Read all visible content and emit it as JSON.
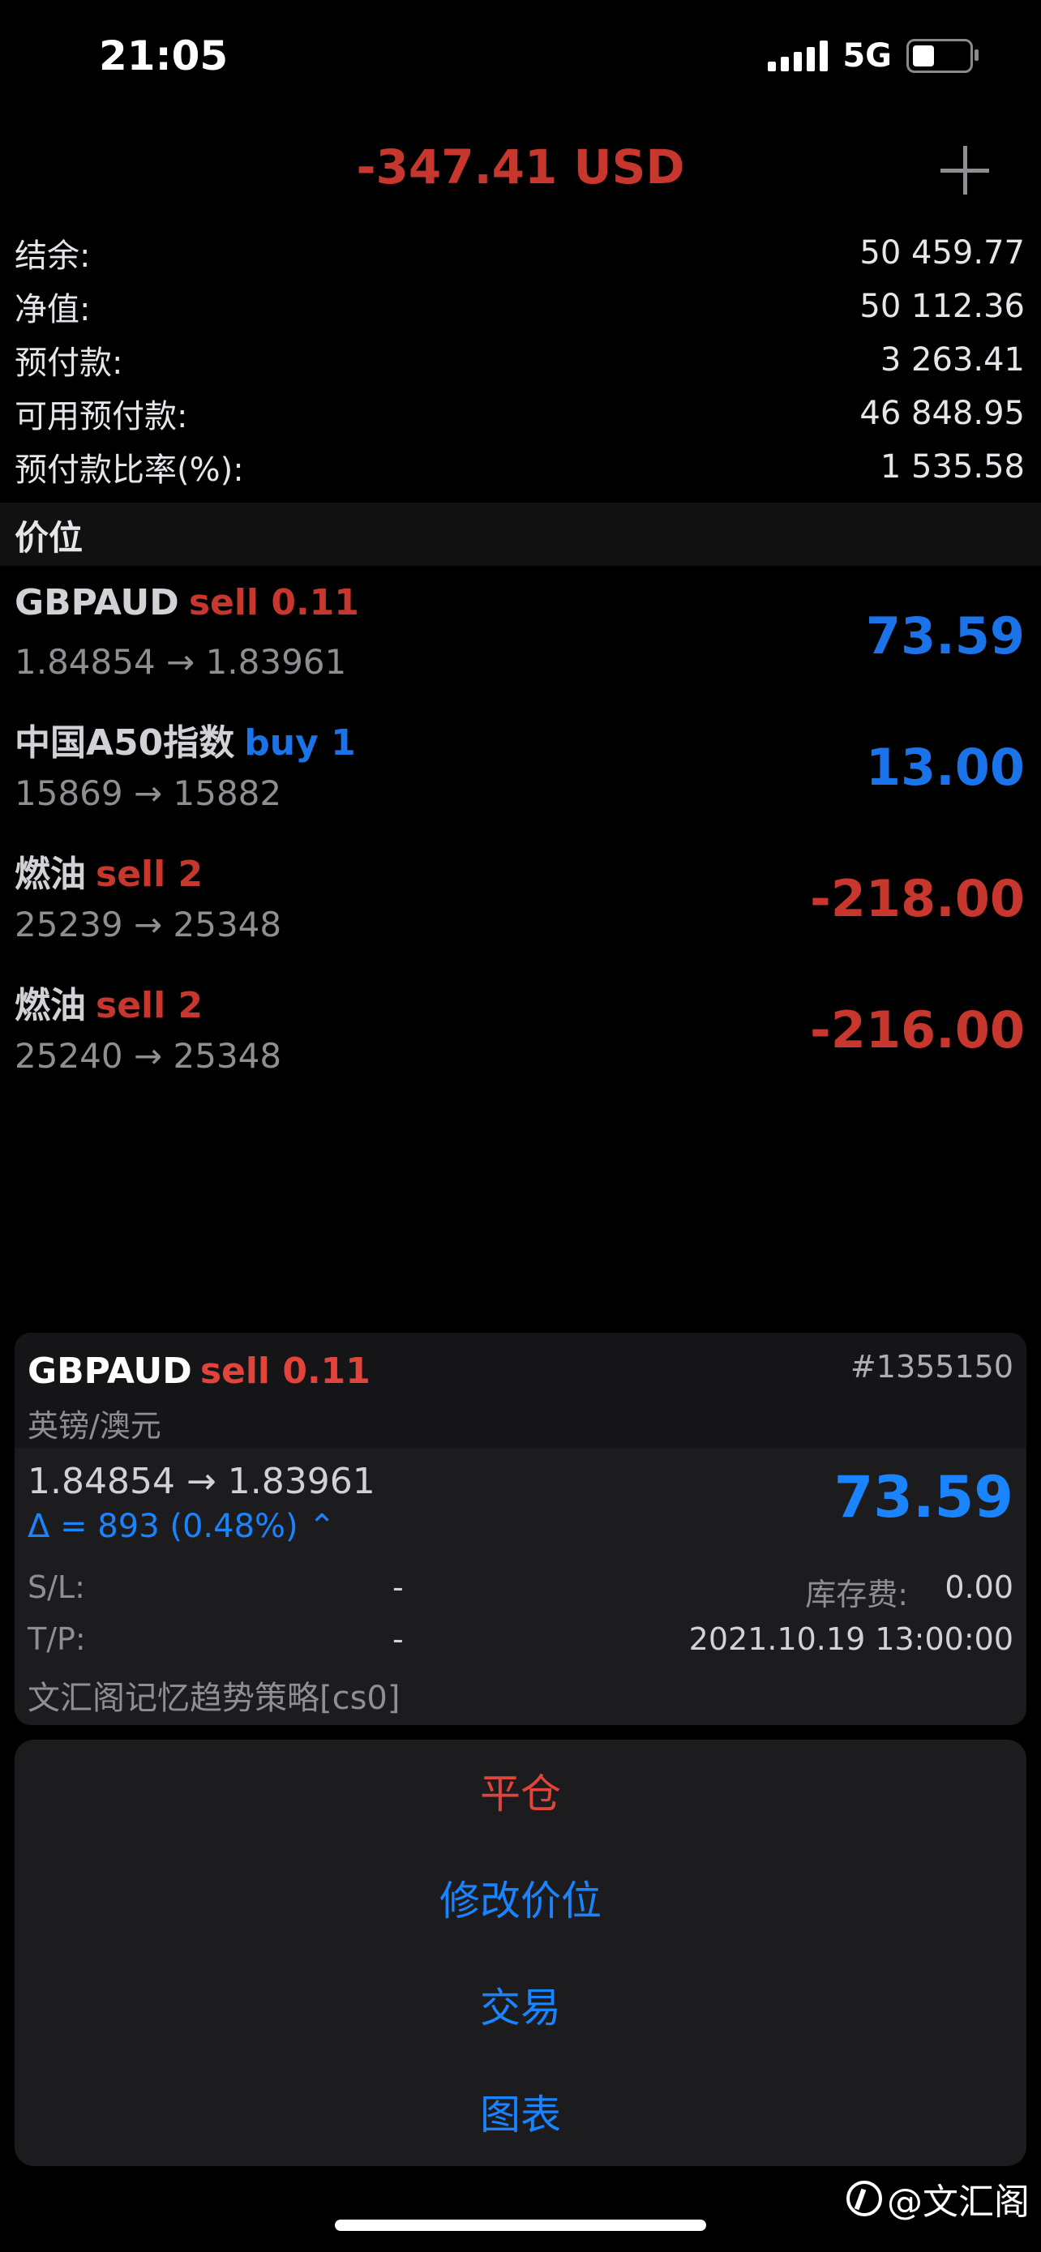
{
  "status_bar": {
    "time": "21:05",
    "network": "5G"
  },
  "header": {
    "total_profit": "-347.41 USD"
  },
  "summary": [
    {
      "label": "结余:",
      "value": "50 459.77"
    },
    {
      "label": "净值:",
      "value": "50 112.36"
    },
    {
      "label": "预付款:",
      "value": "3 263.41"
    },
    {
      "label": "可用预付款:",
      "value": "46 848.95"
    },
    {
      "label": "预付款比率(%):",
      "value": "1 535.58"
    }
  ],
  "positions_title": "价位",
  "positions": [
    {
      "symbol": "GBPAUD",
      "side": "sell 0.11",
      "prices": "1.84854 → 1.83961",
      "profit": "73.59"
    },
    {
      "symbol": "中国A50指数",
      "side": "buy 1",
      "prices": "15869 → 15882",
      "profit": "13.00"
    },
    {
      "symbol": "燃油",
      "side": "sell 2",
      "prices": "25239 → 25348",
      "profit": "-218.00"
    },
    {
      "symbol": "燃油",
      "side": "sell 2",
      "prices": "25240 → 25348",
      "profit": "-216.00"
    }
  ],
  "detail": {
    "symbol": "GBPAUD",
    "side": "sell 0.11",
    "ticket": "#1355150",
    "description": "英镑/澳元",
    "prices": "1.84854 → 1.83961",
    "delta": "Δ = 893 (0.48%) ⌃",
    "profit": "73.59",
    "sl_label": "S/L:",
    "sl_value": "-",
    "tp_label": "T/P:",
    "tp_value": "-",
    "swap_label": "库存费:",
    "swap_value": "0.00",
    "open_time": "2021.10.19 13:00:00",
    "comment": "文汇阁记忆趋势策略[cs0]"
  },
  "actions": {
    "close": "平仓",
    "modify": "修改价位",
    "trade": "交易",
    "chart": "图表"
  },
  "watermark": "@文汇阁",
  "colors": {
    "sell": "#c8372d",
    "buy": "#1a73e8",
    "background": "#000000"
  }
}
